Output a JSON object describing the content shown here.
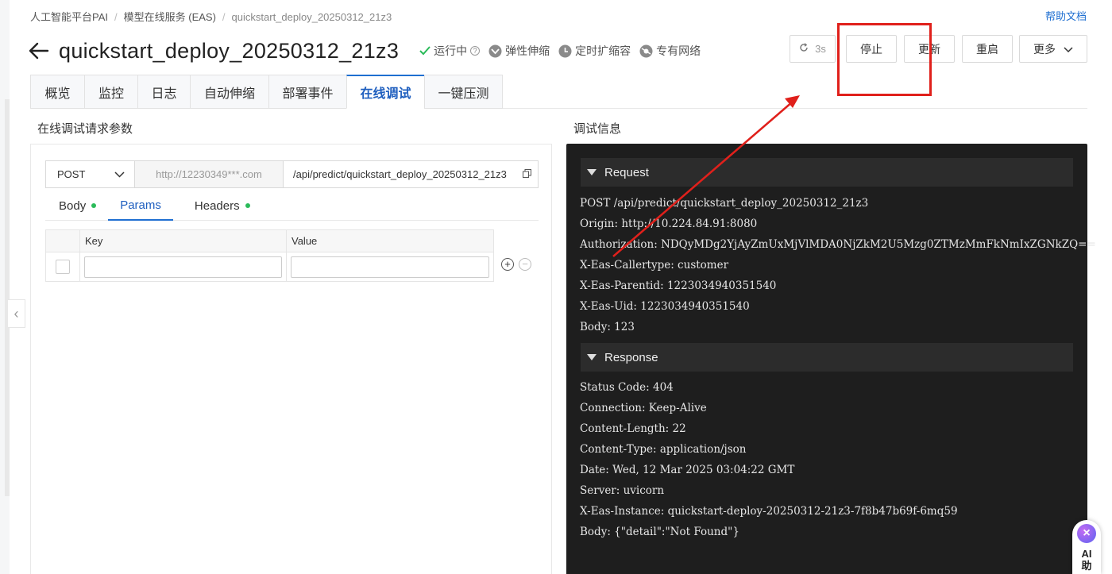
{
  "breadcrumb": {
    "items": [
      "人工智能平台PAI",
      "模型在线服务 (EAS)",
      "quickstart_deploy_20250312_21z3"
    ],
    "separator": "/"
  },
  "help_link": "帮助文档",
  "header": {
    "title": "quickstart_deploy_20250312_21z3",
    "status": "运行中",
    "elastic": "弹性伸缩",
    "scheduled_scaling": "定时扩缩容",
    "vpc": "专有网络"
  },
  "toolbar": {
    "refresh_label": "3s",
    "stop_label": "停止",
    "update_label": "更新",
    "restart_label": "重启",
    "more_label": "更多"
  },
  "tabs": [
    {
      "label": "概览"
    },
    {
      "label": "监控"
    },
    {
      "label": "日志"
    },
    {
      "label": "自动伸缩"
    },
    {
      "label": "部署事件"
    },
    {
      "label": "在线调试",
      "active": true
    },
    {
      "label": "一键压测"
    }
  ],
  "left_section_title": "在线调试请求参数",
  "right_section_title": "调试信息",
  "request": {
    "method": "POST",
    "host": "http://12230349***.com",
    "path": "/api/predict/quickstart_deploy_20250312_21z3"
  },
  "subtabs": [
    {
      "label": "Body",
      "dot": true
    },
    {
      "label": "Params",
      "active": true
    },
    {
      "label": "Headers",
      "dot": true
    }
  ],
  "params_table": {
    "key_header": "Key",
    "value_header": "Value",
    "key_value": "",
    "value_value": ""
  },
  "debug": {
    "request_header": "Request",
    "request_lines": [
      "POST /api/predict/quickstart_deploy_20250312_21z3",
      "Origin: http://10.224.84.91:8080",
      "Authorization: NDQyMDg2YjAyZmUxMjVlMDA0NjZkM2U5Mzg0ZTMzMmFkNmIxZGNkZQ==",
      "X-Eas-Callertype: customer",
      "X-Eas-Parentid: 1223034940351540",
      "X-Eas-Uid: 1223034940351540",
      "Body: 123"
    ],
    "response_header": "Response",
    "response_lines": [
      "Status Code: 404",
      "Connection: Keep-Alive",
      "Content-Length: 22",
      "Content-Type: application/json",
      "Date: Wed, 12 Mar 2025 03:04:22 GMT",
      "Server: uvicorn",
      "X-Eas-Instance: quickstart-deploy-20250312-21z3-7f8b47b69f-6mq59",
      "Body: {\"detail\":\"Not Found\"}"
    ]
  },
  "ai_assistant": {
    "line1": "AI",
    "line2": "助"
  },
  "colors": {
    "accent": "#1f6fd1",
    "annotation": "#e0201b",
    "status_ok": "#2bbb5a",
    "console_bg": "#1e1e1e"
  }
}
